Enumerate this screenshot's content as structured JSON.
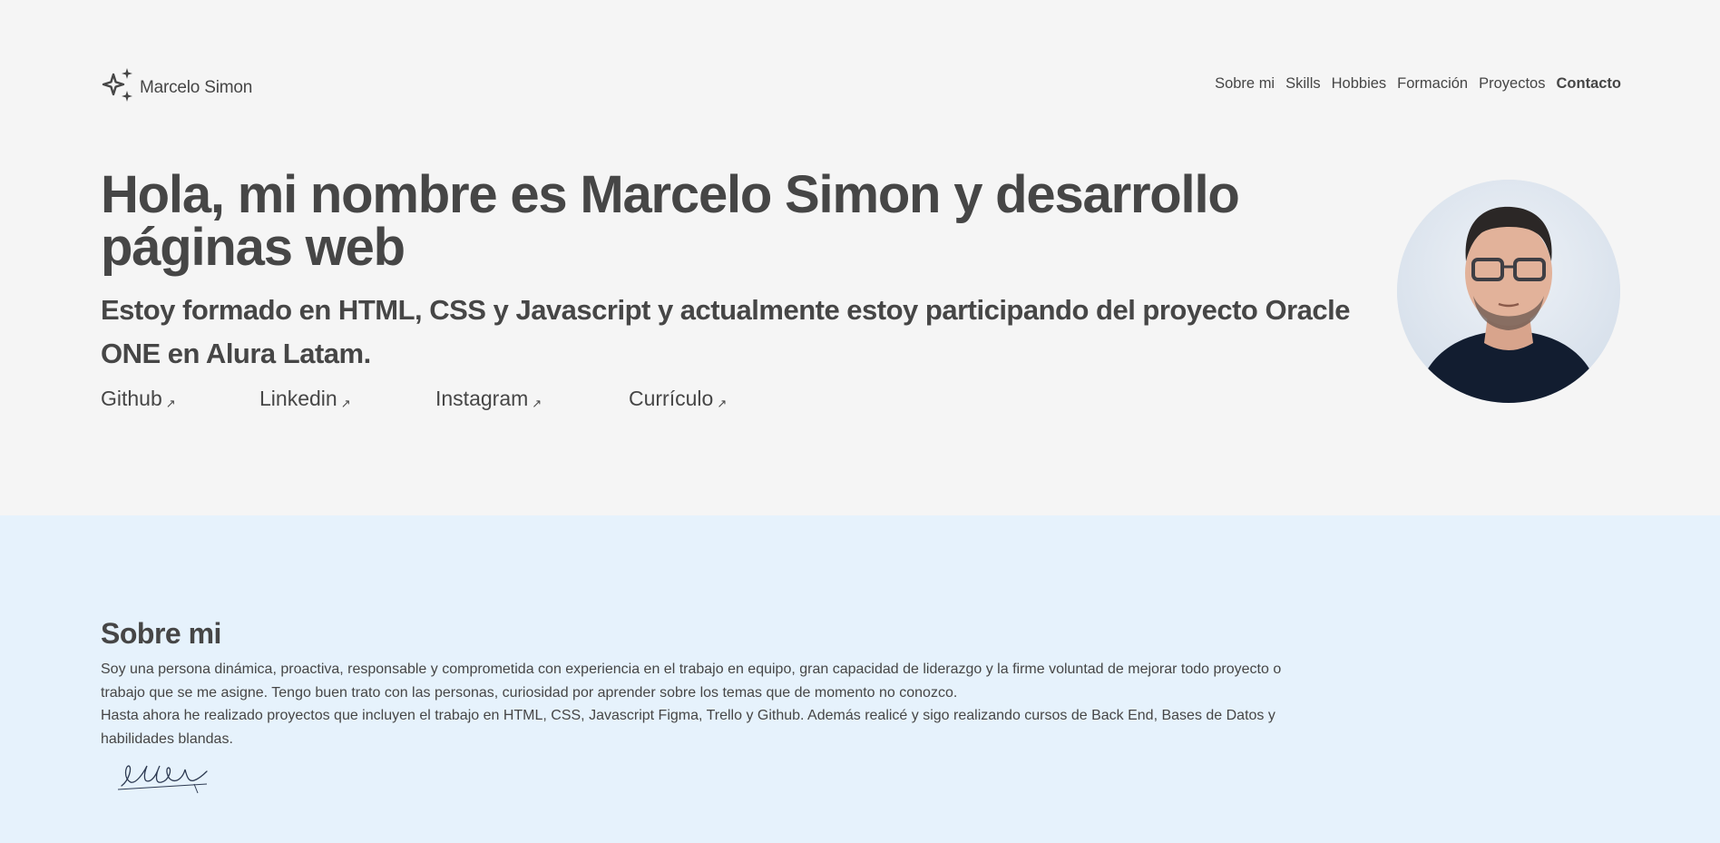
{
  "header": {
    "logo_text": "Marcelo Simon",
    "logo_icon": "sparkles-icon",
    "nav": [
      {
        "label": "Sobre mi",
        "active": false
      },
      {
        "label": "Skills",
        "active": false
      },
      {
        "label": "Hobbies",
        "active": false
      },
      {
        "label": "Formación",
        "active": false
      },
      {
        "label": "Proyectos",
        "active": false
      },
      {
        "label": "Contacto",
        "active": true
      }
    ]
  },
  "hero": {
    "title": "Hola, mi nombre es Marcelo Simon y desarrollo páginas web",
    "subtitle": "Estoy formado en HTML, CSS y Javascript y actualmente estoy participando del proyecto Oracle ONE en Alura Latam.",
    "links": [
      {
        "label": "Github",
        "icon": "external-arrow-icon"
      },
      {
        "label": "Linkedin",
        "icon": "external-arrow-icon"
      },
      {
        "label": "Instagram",
        "icon": "external-arrow-icon"
      },
      {
        "label": "Currículo",
        "icon": "external-arrow-icon"
      }
    ],
    "profile_photo": "profile-photo"
  },
  "about": {
    "title": "Sobre mi",
    "paragraph1": "Soy una persona dinámica, proactiva, responsable y comprometida con experiencia en el trabajo en equipo, gran capacidad de liderazgo y la firme voluntad de mejorar todo proyecto o trabajo que se me asigne. Tengo buen trato con las personas, curiosidad por aprender sobre los temas que de momento no conozco.",
    "paragraph2": "Hasta ahora he realizado proyectos que incluyen el trabajo en HTML, CSS, Javascript Figma, Trello y Github. Además realicé y sigo realizando cursos de Back End, Bases de Datos y habilidades blandas."
  },
  "colors": {
    "text": "#464646",
    "hero_background": "#f5f5f5",
    "about_background": "#e6f2fc"
  }
}
